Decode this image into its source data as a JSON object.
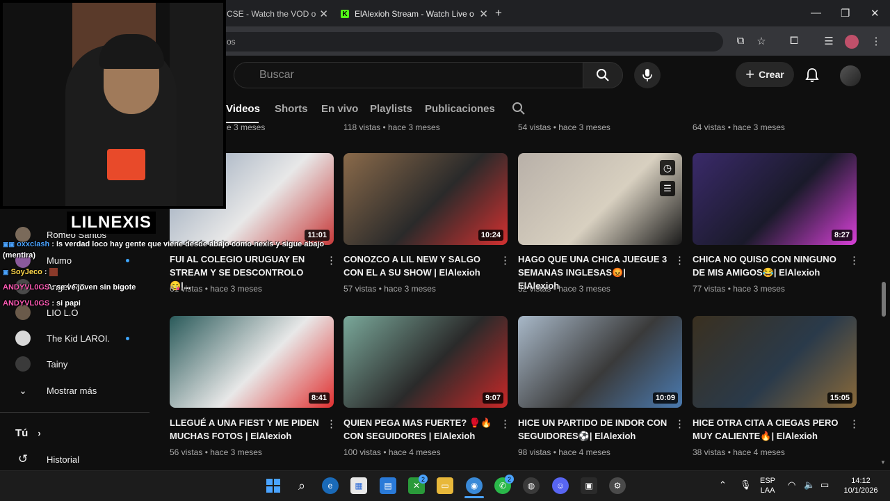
{
  "browser": {
    "tabs": [
      {
        "label": "CSE - Watch the VOD o"
      },
      {
        "label": "ElAlexioh Stream - Watch Live o"
      }
    ],
    "url_fragment": "os",
    "new_tab_symbol": "+",
    "kick_logo_letter": "K"
  },
  "youtube": {
    "search_placeholder": "Buscar",
    "create_label": "Crear",
    "channel_tabs": [
      "Videos",
      "Shorts",
      "En vivo",
      "Playlists",
      "Publicaciones"
    ],
    "top_row_meta": [
      "e 3 meses",
      "118 vistas • hace 3 meses",
      "54 vistas • hace 3 meses",
      "64 vistas • hace 3 meses"
    ],
    "videos": [
      {
        "title": "FUI AL COLEGIO URUGUAY EN STREAM Y SE DESCONTROLO 😋|...",
        "meta": "61 vistas • hace 3 meses",
        "duration": "11:01",
        "colors": [
          "#8fa0b5",
          "#c73a3a",
          "#e8e8e8"
        ]
      },
      {
        "title": "CONOZCO A LIL NEW Y SALGO CON EL A SU SHOW | ElAlexioh",
        "meta": "57 vistas • hace 3 meses",
        "duration": "10:24",
        "colors": [
          "#8a6a4a",
          "#d23030",
          "#2a2a2a"
        ]
      },
      {
        "title": "HAGO QUE UNA CHICA JUEGUE 3 SEMANAS INGLESAS😡| ElAlexioh",
        "meta": "32 vistas • hace 3 meses",
        "duration": "",
        "colors": [
          "#b8b0a8",
          "#1a1a1a",
          "#d8d0c0"
        ]
      },
      {
        "title": "CHICA NO QUISO CON NINGUNO DE MIS AMIGOS😂| ElAlexioh",
        "meta": "77 vistas • hace 3 meses",
        "duration": "8:27",
        "colors": [
          "#3a2a6a",
          "#d840d8",
          "#1a1a2a"
        ]
      },
      {
        "title": "LLEGUÉ A UNA FIEST Y ME PIDEN MUCHAS FOTOS | ElAlexioh",
        "meta": "56 vistas • hace 3 meses",
        "duration": "8:41",
        "colors": [
          "#2a5a5a",
          "#e03030",
          "#e8e8e8"
        ]
      },
      {
        "title": "QUIEN PEGA MAS FUERTE? 🥊🔥 CON SEGUIDORES | ElAlexioh",
        "meta": "100 vistas • hace 4 meses",
        "duration": "9:07",
        "colors": [
          "#7aa89a",
          "#c82828",
          "#2a2a2a"
        ]
      },
      {
        "title": "HICE UN PARTIDO DE INDOR CON SEGUIDORES⚽| ElAlexioh",
        "meta": "98 vistas • hace 4 meses",
        "duration": "10:09",
        "colors": [
          "#a8b8c8",
          "#4a7ab0",
          "#3a3a3a"
        ]
      },
      {
        "title": "HICE OTRA CITA A CIEGAS PERO MUY CALIENTE🔥| ElAlexioh",
        "meta": "38 vistas • hace 4 meses",
        "duration": "15:05",
        "colors": [
          "#3a3020",
          "#8a6a3a",
          "#2a3a4a"
        ]
      }
    ]
  },
  "sidebar": {
    "channels": [
      {
        "name": "Romeo Santos",
        "live": false
      },
      {
        "name": "Mumo",
        "live": true
      },
      {
        "name": "Angel RG",
        "live": false
      },
      {
        "name": "LIO L.O",
        "live": false
      },
      {
        "name": "The Kid LAROI.",
        "live": true
      },
      {
        "name": "Tainy",
        "live": false
      }
    ],
    "show_more": "Mostrar más",
    "you_section": "Tú",
    "history": "Historial"
  },
  "chat": [
    {
      "user": "oxxclash",
      "text": ": Is verdad loco hay gente que viene desde abajo como nexis y sigue abajo (mentira)",
      "color": "#4aa3ff"
    },
    {
      "user": "SoyJeco",
      "text": ":",
      "color": "#ffd84a"
    },
    {
      "user": "ANDYVL0GS",
      "text": ": se ve joven sin bigote",
      "color": "#ff5ab4"
    },
    {
      "user": "ANDYVL0GS",
      "text": ": si papi",
      "color": "#ff5ab4"
    }
  ],
  "webcam": {
    "label": "LILNEXIS"
  },
  "taskbar": {
    "lang": "ESP",
    "layout": "LAA",
    "time": "14:12",
    "date": "10/1/2026",
    "badges": [
      "2",
      "2"
    ]
  }
}
